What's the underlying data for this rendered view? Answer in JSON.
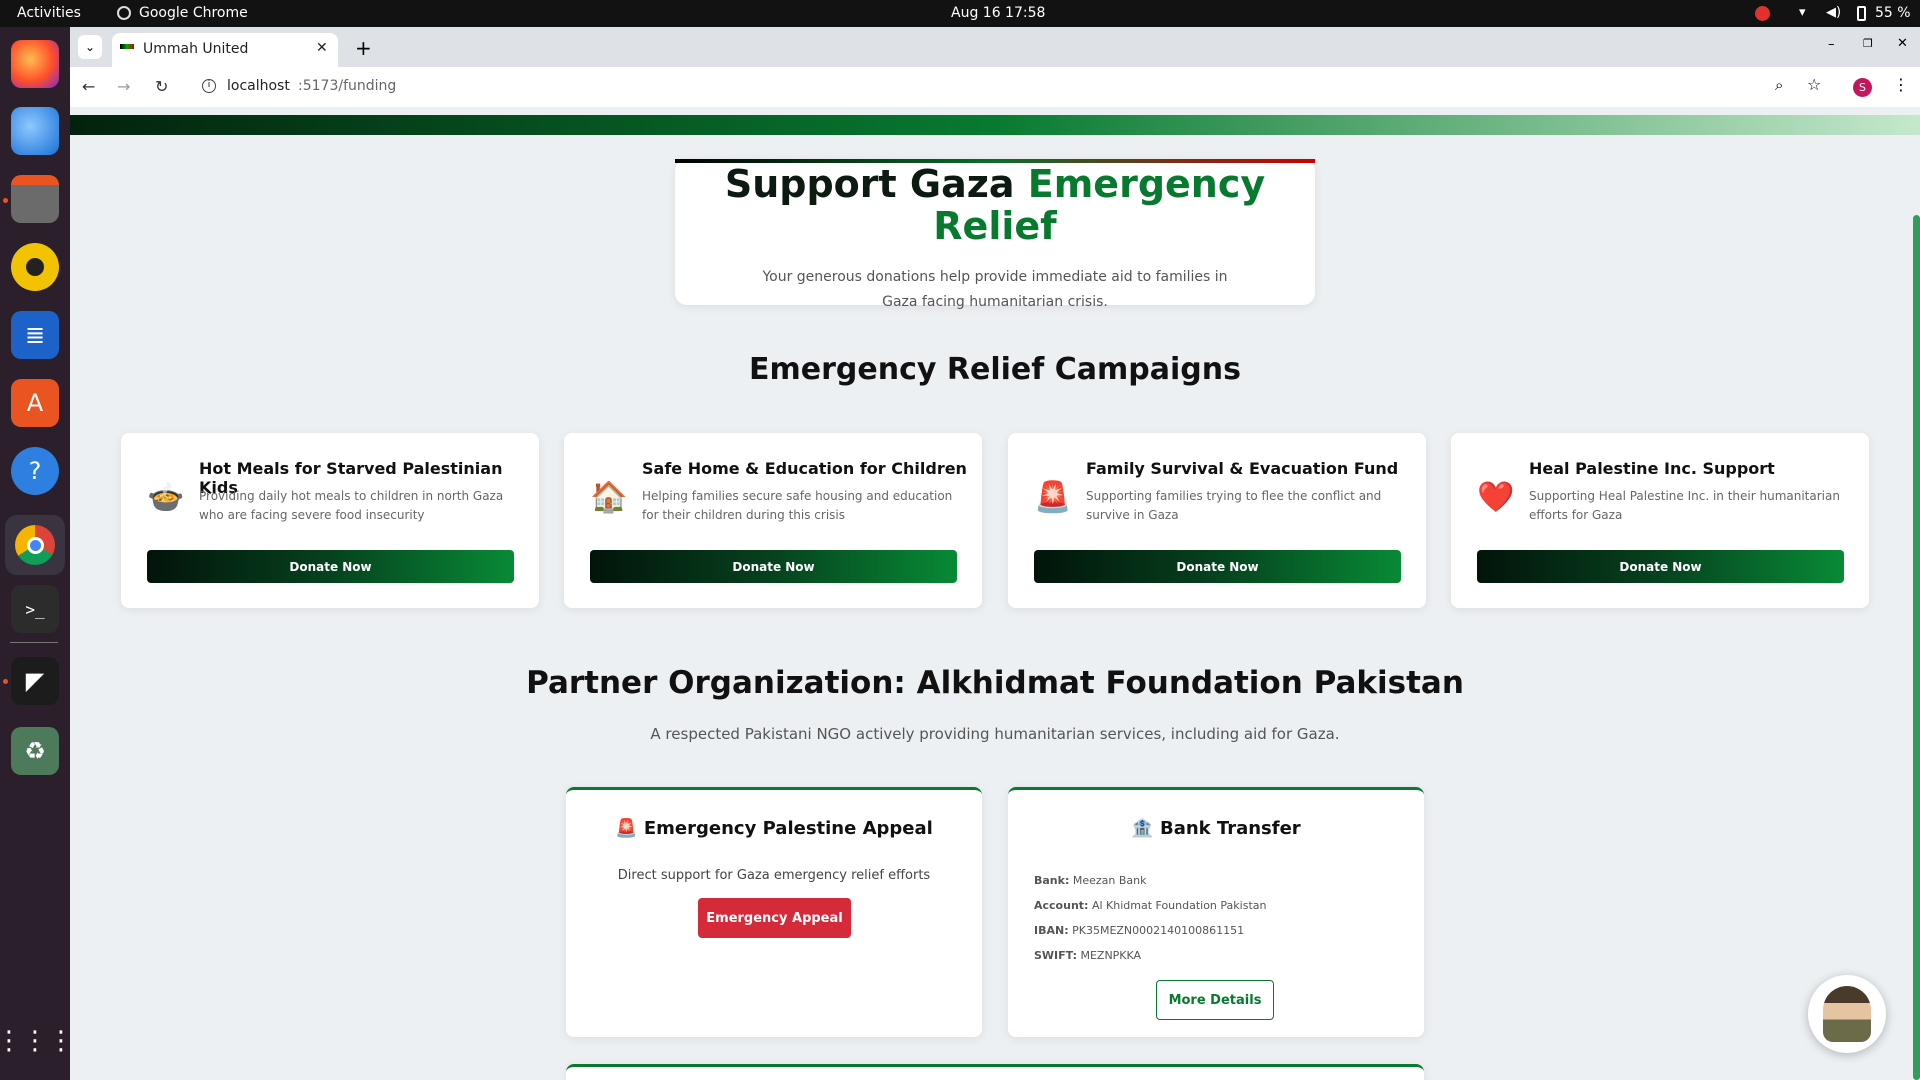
{
  "os": {
    "activities": "Activities",
    "app_name": "Google Chrome",
    "datetime": "Aug 16  17:58",
    "battery": "55 %"
  },
  "dock": {
    "items": [
      "firefox",
      "thunderbird",
      "files",
      "rhythmbox",
      "writer",
      "app-center",
      "help",
      "chrome",
      "terminal",
      "other-app",
      "trash",
      "show-apps"
    ]
  },
  "browser": {
    "tab_title": "Ummah United",
    "url_host": "localhost",
    "url_path": ":5173/funding",
    "profile_initial": "S"
  },
  "hero": {
    "title_a": "Support Gaza",
    "title_b": "Emergency",
    "title_c": "Relief",
    "subtitle": "Your generous donations help provide immediate aid to families in Gaza facing humanitarian crisis."
  },
  "campaigns": {
    "heading": "Emergency Relief Campaigns",
    "items": [
      {
        "icon": "🍲",
        "title": "Hot Meals for Starved Palestinian Kids",
        "desc": "Providing daily hot meals to children in north Gaza who are facing severe food insecurity",
        "button": "Donate Now"
      },
      {
        "icon": "🏠",
        "title": "Safe Home & Education for Children",
        "desc": "Helping families secure safe housing and education for their children during this crisis",
        "button": "Donate Now"
      },
      {
        "icon": "🚨",
        "title": "Family Survival & Evacuation Fund",
        "desc": "Supporting families trying to flee the conflict and survive in Gaza",
        "button": "Donate Now"
      },
      {
        "icon": "❤️",
        "title": "Heal Palestine Inc. Support",
        "desc": "Supporting Heal Palestine Inc. in their humanitarian efforts for Gaza",
        "button": "Donate Now"
      }
    ]
  },
  "partner": {
    "heading": "Partner Organization: Alkhidmat Foundation Pakistan",
    "subtitle": "A respected Pakistani NGO actively providing humanitarian services, including aid for Gaza.",
    "appeal": {
      "icon": "🚨",
      "title": "Emergency Palestine Appeal",
      "desc": "Direct support for Gaza emergency relief efforts",
      "button": "Emergency Appeal"
    },
    "bank": {
      "icon": "🏦",
      "title": "Bank Transfer",
      "bank_label": "Bank:",
      "bank": "Meezan Bank",
      "account_label": "Account:",
      "account": "Al Khidmat Foundation Pakistan",
      "iban_label": "IBAN:",
      "iban": "PK35MEZN0002140100861151",
      "swift_label": "SWIFT:",
      "swift": "MEZNPKKA",
      "button": "More Details"
    }
  },
  "colors": {
    "green": "#087a30",
    "dark_green": "#04200f",
    "red": "#d42a3a",
    "hero_title_dark": "#0c1a12"
  }
}
